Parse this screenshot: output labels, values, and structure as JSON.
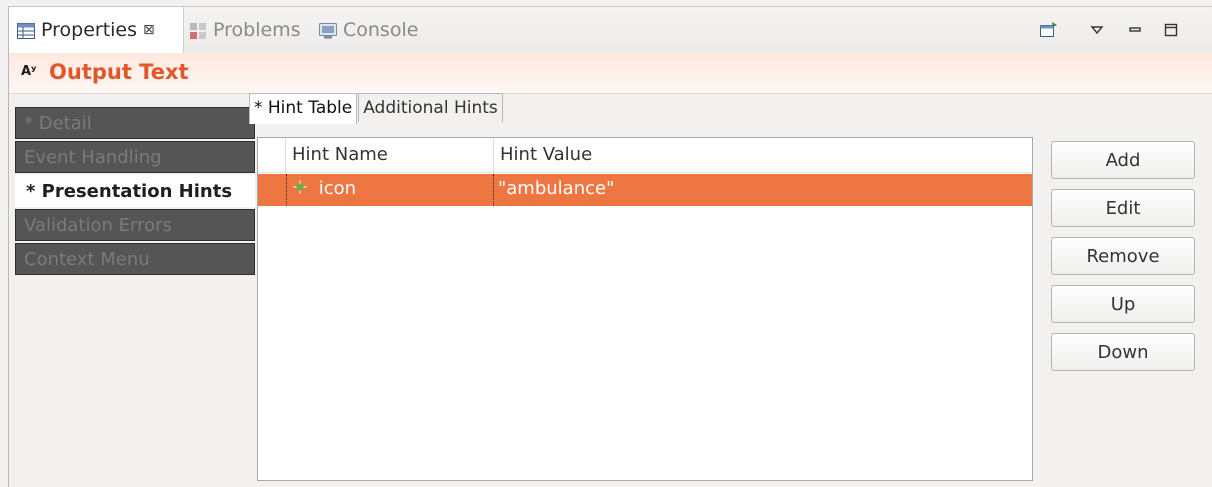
{
  "view_tabs": [
    {
      "label": "Properties",
      "icon": "properties-table-icon",
      "active": true
    },
    {
      "label": "Problems",
      "icon": "problems-icon",
      "active": false
    },
    {
      "label": "Console",
      "icon": "console-icon",
      "active": false
    }
  ],
  "close_glyph": "⊠",
  "toolbar": {
    "pin_icon": "pin-view-icon",
    "menu_icon": "view-menu-icon",
    "minimize_icon": "minimize-icon",
    "maximize_icon": "maximize-icon"
  },
  "header": {
    "icon_text": "Aʸ",
    "title": "Output Text"
  },
  "left_tabs": [
    {
      "label": "* Detail",
      "active": false
    },
    {
      "label": "Event Handling",
      "active": false
    },
    {
      "label": "* Presentation Hints",
      "active": true
    },
    {
      "label": "Validation Errors",
      "active": false
    },
    {
      "label": "Context Menu",
      "active": false
    }
  ],
  "sub_tabs": [
    {
      "label": "* Hint Table",
      "active": true
    },
    {
      "label": "Additional Hints",
      "active": false
    }
  ],
  "table": {
    "columns": [
      "Hint Name",
      "Hint Value"
    ],
    "rows": [
      {
        "name": "icon",
        "value": "\"ambulance\"",
        "selected": true
      }
    ]
  },
  "buttons": [
    "Add",
    "Edit",
    "Remove",
    "Up",
    "Down"
  ],
  "colors": {
    "accent": "#e2572a",
    "selection": "#ed7642",
    "inactive_tab": "#555555"
  }
}
